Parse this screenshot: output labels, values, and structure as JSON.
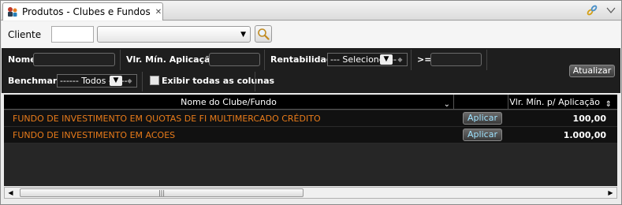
{
  "tab": {
    "title": "Produtos - Clubes e Fundos",
    "close_glyph": "✕"
  },
  "toolbar_right": {
    "link_icon": "link-icon",
    "menu_icon": "chevron-down-icon"
  },
  "client": {
    "label": "Cliente",
    "code_value": "",
    "select_value": "",
    "search_icon": "search-icon"
  },
  "filters": {
    "nome_label": "Nome",
    "nome_value": "",
    "vlr_min_label": "Vlr. Mín. Aplicação <",
    "vlr_min_value": "",
    "rentabilidade_label": "Rentabilidade:",
    "rentabilidade_selected": "--- Selecione ---",
    "gte_label": ">=",
    "gte_value": "",
    "benchmark_label": "Benchmark:",
    "benchmark_selected": "------ Todos ------",
    "exibir_label": "Exibir todas as colunas",
    "exibir_checked": false,
    "atualizar_label": "Atualizar"
  },
  "grid": {
    "columns": [
      "Nome do Clube/Fundo",
      "",
      "Vlr. Mín. p/ Aplicação"
    ],
    "rows": [
      {
        "name": "FUNDO DE INVESTIMENTO EM QUOTAS DE FI MULTIMERCADO CRÉDITO",
        "action": "Aplicar",
        "value": "100,00"
      },
      {
        "name": "FUNDO DE INVESTIMENTO EM ACOES",
        "action": "Aplicar",
        "value": "1.000,00"
      }
    ]
  },
  "colors": {
    "fund_name": "#e87b1a",
    "apply_text": "#9fe3ff",
    "filter_bg": "#1e1e1e"
  }
}
